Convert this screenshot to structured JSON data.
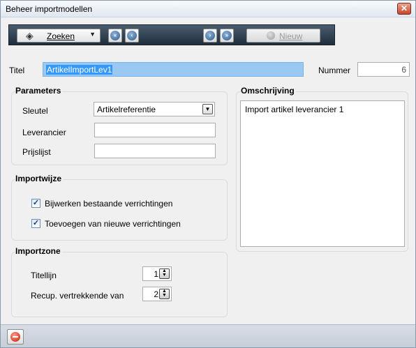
{
  "window": {
    "title": "Beheer importmodellen",
    "close_symbol": "✕"
  },
  "toolbar": {
    "search_label": "Zoeken",
    "search_icon": "binoculars-icon",
    "first_icon": "first-record-icon",
    "prev_icon": "previous-record-icon",
    "next_icon": "next-record-icon",
    "last_icon": "last-record-icon",
    "new_label": "Nieuw",
    "new_enabled": false
  },
  "form": {
    "titel_label": "Titel",
    "titel_value": "ArtikelImportLev1",
    "nummer_label": "Nummer",
    "nummer_value": "6"
  },
  "parameters": {
    "title": "Parameters",
    "sleutel_label": "Sleutel",
    "sleutel_value": "Artikelreferentie",
    "leverancier_label": "Leverancier",
    "leverancier_value": "",
    "prijslijst_label": "Prijslijst",
    "prijslijst_value": ""
  },
  "importwijze": {
    "title": "Importwijze",
    "options": [
      {
        "label": "Bijwerken bestaande verrichtingen",
        "checked": true
      },
      {
        "label": "Toevoegen van nieuwe verrichtingen",
        "checked": true
      }
    ]
  },
  "importzone": {
    "title": "Importzone",
    "titellijn_label": "Titellijn",
    "titellijn_value": "1",
    "recup_label": "Recup. vertrekkende van",
    "recup_value": "2"
  },
  "omschrijving": {
    "title": "Omschrijving",
    "value": "Import artikel leverancier 1"
  },
  "statusbar": {
    "stop_icon": "stop-icon"
  },
  "colors": {
    "toolbar_bg": "#2e3e4e",
    "selection": "#3399ff",
    "titlebar_bg": "#e8edf4"
  }
}
